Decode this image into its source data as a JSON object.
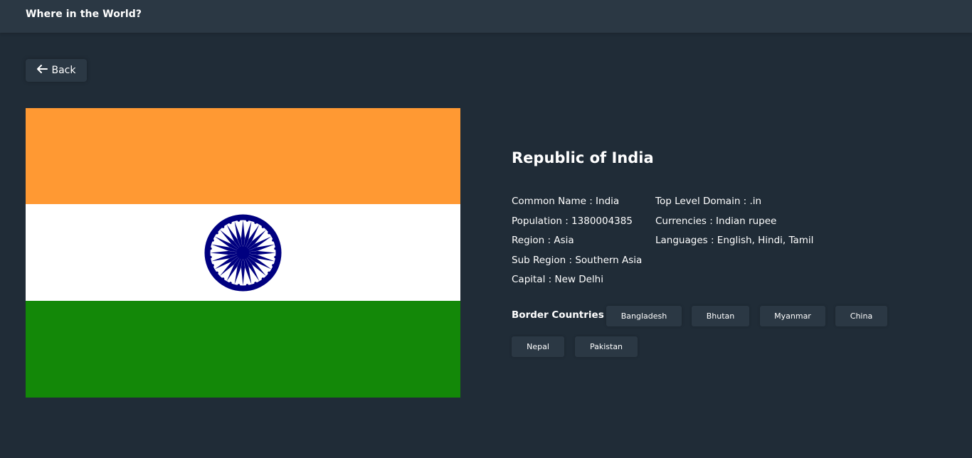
{
  "header": {
    "title": "Where in the World?"
  },
  "back_button": {
    "label": "Back",
    "icon": "arrow-left-icon"
  },
  "flag": {
    "description_colors": {
      "top": "#ff9933",
      "middle": "#ffffff",
      "bottom": "#138808",
      "chakra": "#000080"
    }
  },
  "country": {
    "name": "Republic of India",
    "left_column": [
      "Common Name : India",
      "Population : 1380004385",
      "Region : Asia",
      "Sub Region : Southern Asia",
      "Capital : New Delhi"
    ],
    "right_column": [
      "Top Level Domain : .in",
      "Currencies : Indian rupee",
      "Languages : English, Hindi, Tamil"
    ],
    "border_label": "Border Countries :",
    "borders": [
      "Bangladesh",
      "Bhutan",
      "Myanmar",
      "China",
      "Nepal",
      "Pakistan"
    ]
  }
}
